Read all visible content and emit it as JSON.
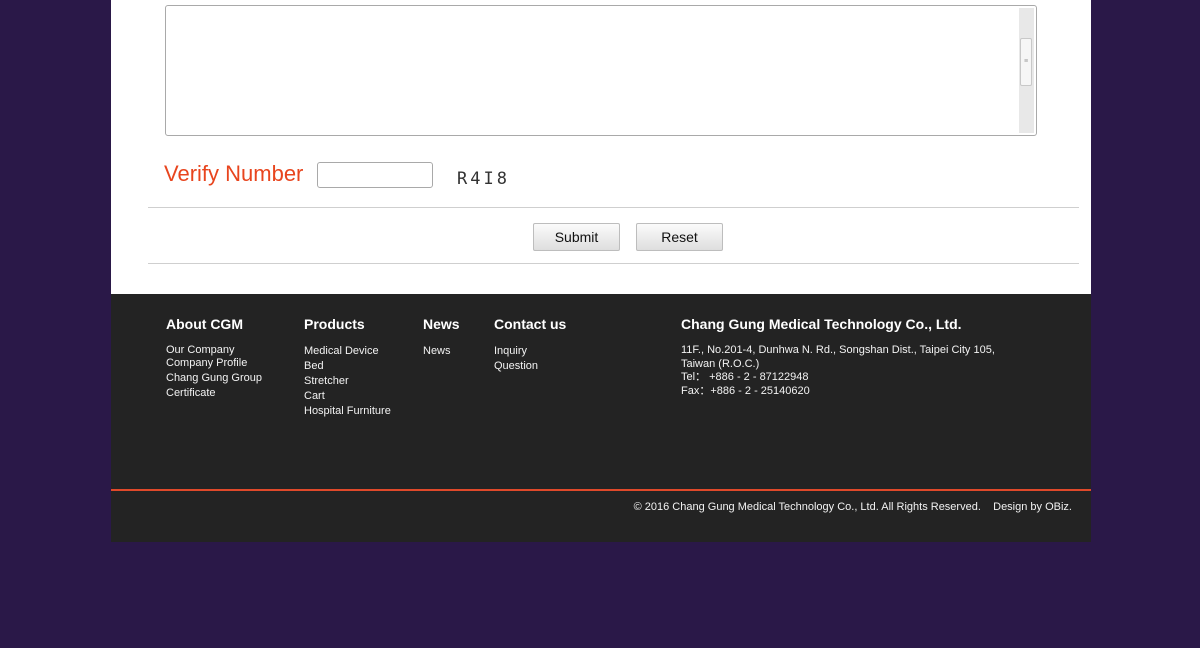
{
  "form": {
    "verify_label": "Verify Number",
    "verify_value": "",
    "captcha": "R4I8",
    "submit_label": "Submit",
    "reset_label": "Reset"
  },
  "footer": {
    "columns": [
      {
        "title": "About CGM",
        "links": [
          "Our Company",
          "Company Profile",
          "Chang Gung Group",
          "Certificate"
        ]
      },
      {
        "title": "Products",
        "links": [
          "Medical Device",
          "Bed",
          "Stretcher",
          "Cart",
          "Hospital Furniture"
        ]
      },
      {
        "title": "News",
        "links": [
          "News"
        ]
      },
      {
        "title": "Contact us",
        "links": [
          "Inquiry",
          "Question"
        ]
      }
    ],
    "company": {
      "name": "Chang Gung Medical Technology Co., Ltd.",
      "address_1": "11F., No.201-4, Dunhwa N. Rd., Songshan Dist., Taipei City 105,",
      "address_2": "Taiwan (R.O.C.)",
      "tel": "Tel： +886 - 2 - 87122948",
      "fax": "Fax：+886 - 2 - 25140620"
    },
    "copyright": "© 2016 Chang Gung Medical Technology Co., Ltd. All Rights Reserved.",
    "design_credit": "Design by OBiz."
  },
  "colors": {
    "page_background": "#2a1848",
    "accent_red": "#e8451e",
    "footer_background": "#232323"
  }
}
